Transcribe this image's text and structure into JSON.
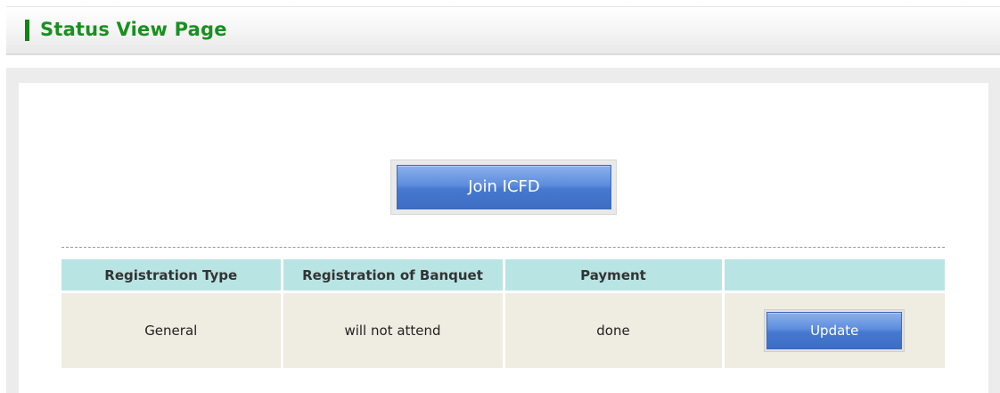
{
  "header": {
    "title": "Status View Page",
    "accent_color": "#128212",
    "title_color": "#18901f"
  },
  "actions": {
    "join_label": "Join ICFD"
  },
  "table": {
    "columns": [
      "Registration Type",
      "Registration of Banquet",
      "Payment",
      ""
    ],
    "rows": [
      {
        "registration_type": "General",
        "banquet": "will not attend",
        "payment": "done",
        "action_label": "Update"
      }
    ],
    "header_color": "#b9e4e4",
    "row_color": "#efece1"
  },
  "button_color": "#4678cf"
}
